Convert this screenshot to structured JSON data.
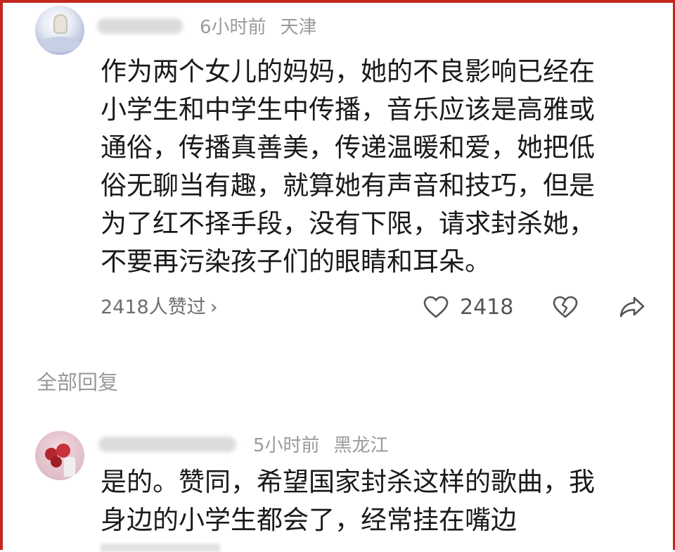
{
  "comment": {
    "time": "6小时前",
    "location": "天津",
    "lines": [
      "作为两个女儿的妈妈，她的不良影响已经在",
      "小学生和中学生中传播，音乐应该是高雅或",
      "通俗，传播真善美，传递温暖和爱，她把低",
      "俗无聊当有趣，就算她有声音和技巧，但是",
      "为了红不择手段，没有下限，请求封杀她，",
      "不要再污染孩子们的眼睛和耳朵。"
    ],
    "likes_summary": "2418人赞过",
    "likes_chevron": "›",
    "like_count": "2418",
    "icons": {
      "like": "heart-outline-icon",
      "dislike": "broken-heart-icon",
      "share": "share-arrow-icon"
    }
  },
  "replies_header": "全部回复",
  "reply": {
    "time": "5小时前",
    "location": "黑龙江",
    "lines": [
      "是的。赞同，希望国家封杀这样的歌曲，我",
      "身边的小学生都会了，经常挂在嘴边"
    ]
  },
  "colors": {
    "frame": "#c2271e",
    "text": "#1a1a1a",
    "meta": "#9a9a9a",
    "icon": "#555555"
  }
}
